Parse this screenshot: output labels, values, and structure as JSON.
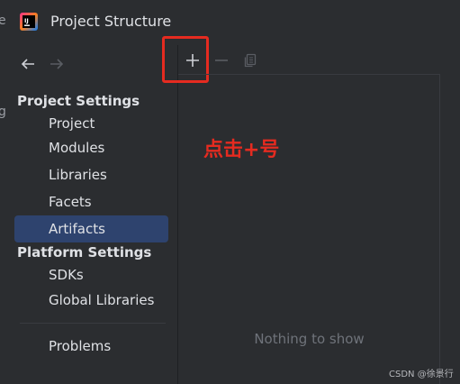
{
  "window": {
    "title": "Project Structure",
    "logo_text": "IJ"
  },
  "background": {
    "frag_top": "e",
    "frag_mid": "g"
  },
  "nav": {
    "back_icon": "arrow-left-icon",
    "forward_icon": "arrow-right-icon"
  },
  "sidebar": {
    "project_settings_header": "Project Settings",
    "project_items": [
      {
        "label": "Project"
      },
      {
        "label": "Modules"
      },
      {
        "label": "Libraries"
      },
      {
        "label": "Facets"
      },
      {
        "label": "Artifacts",
        "selected": true
      }
    ],
    "platform_settings_header": "Platform Settings",
    "platform_items": [
      {
        "label": "SDKs"
      },
      {
        "label": "Global Libraries"
      }
    ],
    "other_items": [
      {
        "label": "Problems"
      }
    ]
  },
  "toolbar": {
    "add_icon": "plus-icon",
    "remove_icon": "minus-icon",
    "copy_icon": "copy-icon"
  },
  "list": {
    "empty_text": "Nothing to show"
  },
  "annotation": {
    "text": "点击+号"
  },
  "watermark": {
    "text": "CSDN @徐景行"
  },
  "colors": {
    "accent_selection": "#2e436e",
    "annotation_red": "#e52b20",
    "background": "#2b2d30"
  }
}
